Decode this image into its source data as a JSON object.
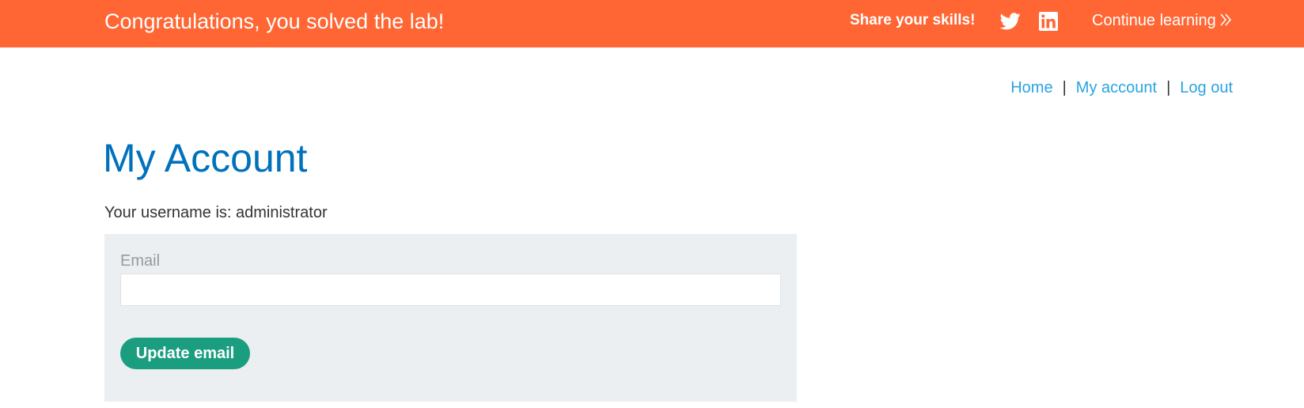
{
  "banner": {
    "title": "Congratulations, you solved the lab!",
    "share_label": "Share your skills!",
    "icons": [
      "twitter-icon",
      "linkedin-icon",
      "chevrons-right-icon"
    ],
    "continue_label": "Continue learning",
    "background_color": "#ff6633"
  },
  "nav": {
    "home": "Home",
    "separator": "|",
    "my_account": "My account",
    "log_out": "Log out",
    "link_color": "#29a3e0"
  },
  "main": {
    "title": "My Account",
    "username_text": "Your username is: administrator",
    "title_color": "#0071bc"
  },
  "email_form": {
    "label": "Email",
    "value": "",
    "placeholder": "",
    "button_label": "Update email",
    "button_color": "#1a9e7f",
    "panel_color": "#ebeff2"
  }
}
